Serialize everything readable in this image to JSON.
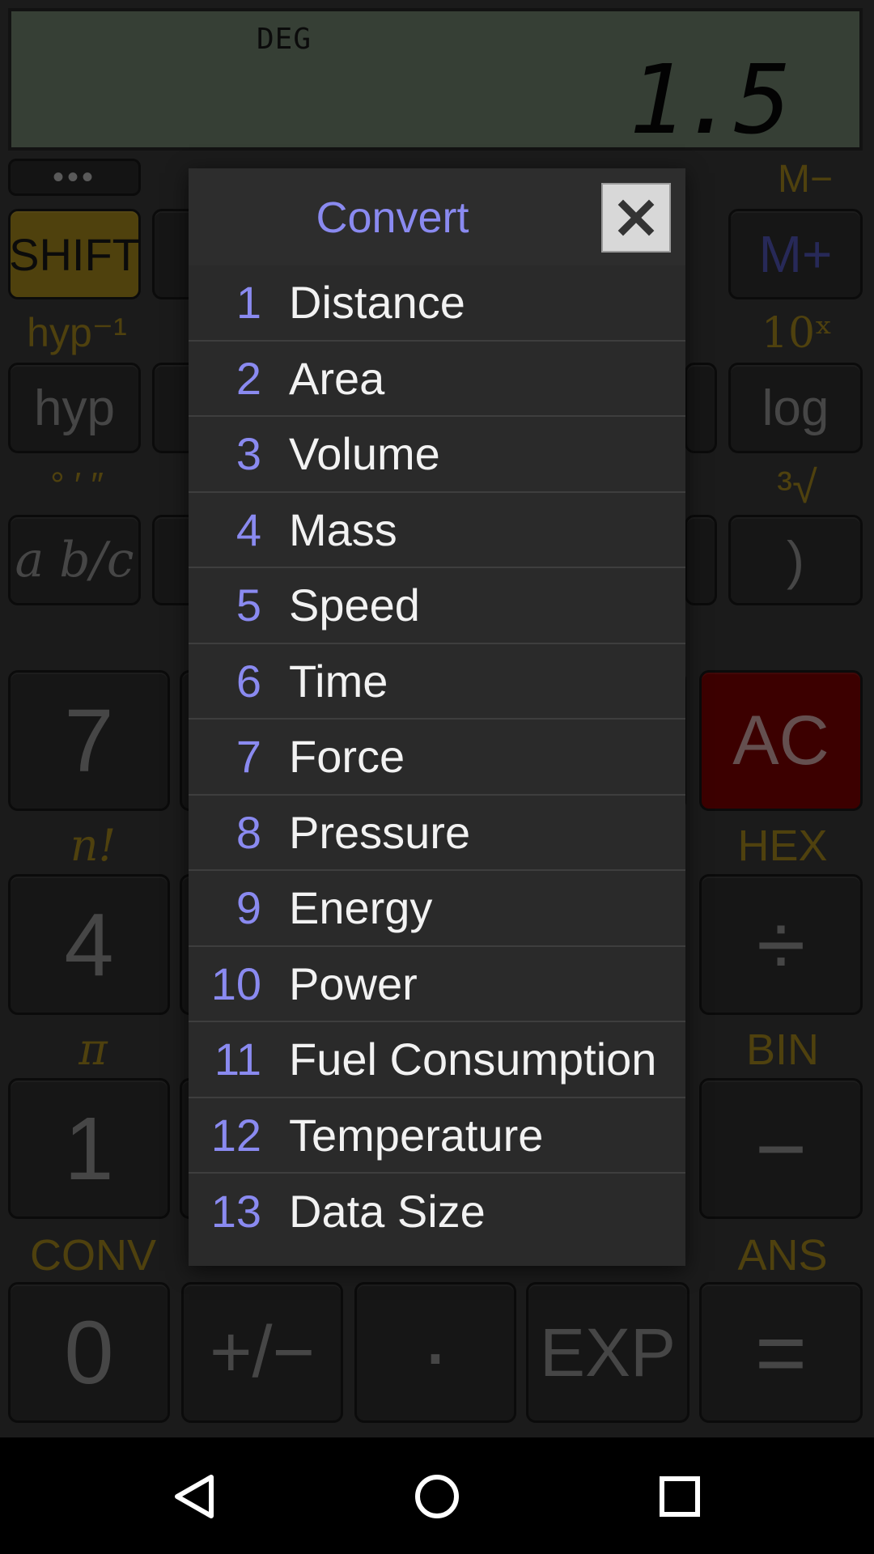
{
  "display": {
    "mode": "DEG",
    "value": "1.5"
  },
  "keypad": {
    "more_button": "•••",
    "shift": "SHIFT",
    "m_minus_label": "M−",
    "m_plus": "M+",
    "hyp_inv_label": "hyp⁻¹",
    "hyp": "hyp",
    "ten_x_label": "10ˣ",
    "log": "log",
    "deg_min_sec_label": "° ′ ″",
    "cube_root_label": "³√",
    "fraction": "a b/c",
    "close_paren": ")",
    "seven": "7",
    "ac": "AC",
    "factorial_label": "n!",
    "hex_label": "HEX",
    "four": "4",
    "divide": "÷",
    "pi_label": "π",
    "bin_label": "BIN",
    "one": "1",
    "minus": "−",
    "conv_label": "CONV",
    "ans_label": "ANS",
    "zero": "0",
    "plus_minus": "+/−",
    "decimal": "·",
    "exp": "EXP",
    "equals": "="
  },
  "dialog": {
    "title": "Convert",
    "close_icon": "close-icon",
    "items": [
      {
        "num": "1",
        "label": "Distance"
      },
      {
        "num": "2",
        "label": "Area"
      },
      {
        "num": "3",
        "label": "Volume"
      },
      {
        "num": "4",
        "label": "Mass"
      },
      {
        "num": "5",
        "label": "Speed"
      },
      {
        "num": "6",
        "label": "Time"
      },
      {
        "num": "7",
        "label": "Force"
      },
      {
        "num": "8",
        "label": "Pressure"
      },
      {
        "num": "9",
        "label": "Energy"
      },
      {
        "num": "10",
        "label": "Power"
      },
      {
        "num": "11",
        "label": "Fuel Consumption"
      },
      {
        "num": "12",
        "label": "Temperature"
      },
      {
        "num": "13",
        "label": "Data Size"
      }
    ]
  },
  "colors": {
    "accent": "#8a8af0",
    "shift": "#7a6414",
    "ac": "#5c0000",
    "lcd": "#536152"
  },
  "navbar": {
    "back_icon": "back-triangle-icon",
    "home_icon": "home-circle-icon",
    "recents_icon": "recents-square-icon"
  }
}
